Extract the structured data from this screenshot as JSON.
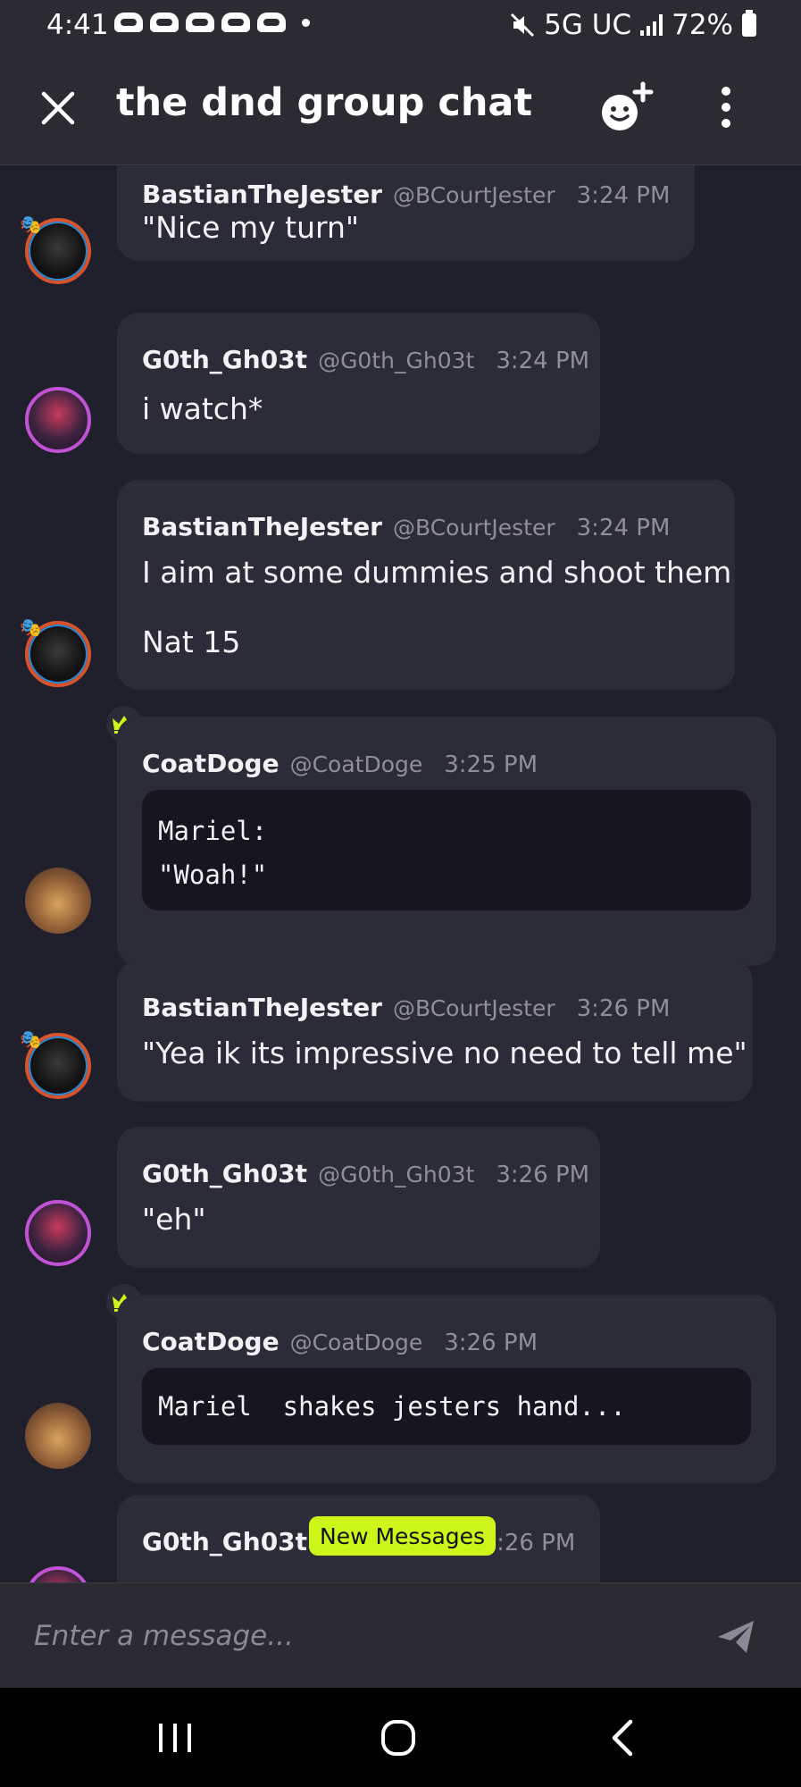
{
  "status_bar": {
    "time": "4:41",
    "network": "5G UC",
    "battery": "72%"
  },
  "header": {
    "title": "the dnd group chat"
  },
  "messages": [
    {
      "name": "BastianTheJester",
      "handle": "@BCourtJester",
      "time": "3:24 PM",
      "lines": [
        "\"Nice my turn\""
      ]
    },
    {
      "name": "G0th_Gh03t",
      "handle": "@G0th_Gh03t",
      "time": "3:24 PM",
      "lines": [
        "i watch*"
      ]
    },
    {
      "name": "BastianTheJester",
      "handle": "@BCourtJester",
      "time": "3:24 PM",
      "lines": [
        "I aim at some dummies and shoot them",
        "Nat 15"
      ]
    },
    {
      "name": "CoatDoge",
      "handle": "@CoatDoge",
      "time": "3:25 PM",
      "code": [
        "Mariel:",
        "\"Woah!\""
      ]
    },
    {
      "name": "BastianTheJester",
      "handle": "@BCourtJester",
      "time": "3:26 PM",
      "lines": [
        "\"Yea ik its impressive no need to tell me\""
      ]
    },
    {
      "name": "G0th_Gh03t",
      "handle": "@G0th_Gh03t",
      "time": "3:26 PM",
      "lines": [
        "\"eh\""
      ]
    },
    {
      "name": "CoatDoge",
      "handle": "@CoatDoge",
      "time": "3:26 PM",
      "code": [
        "Mariel  shakes jesters hand..."
      ]
    },
    {
      "name": "G0th_Gh03t",
      "handle": "",
      "time": ":26 PM",
      "lines": []
    }
  ],
  "new_messages_label": "New Messages",
  "composer": {
    "placeholder": "Enter a message..."
  },
  "icons": {
    "close": "close-icon",
    "add_emoji": "add-emoji-icon",
    "menu": "more-vertical-icon",
    "send": "send-icon",
    "crown": "crown-icon"
  },
  "colors": {
    "accent": "#ccf61a",
    "background": "#201f2c",
    "bubble": "#2c2b38"
  }
}
